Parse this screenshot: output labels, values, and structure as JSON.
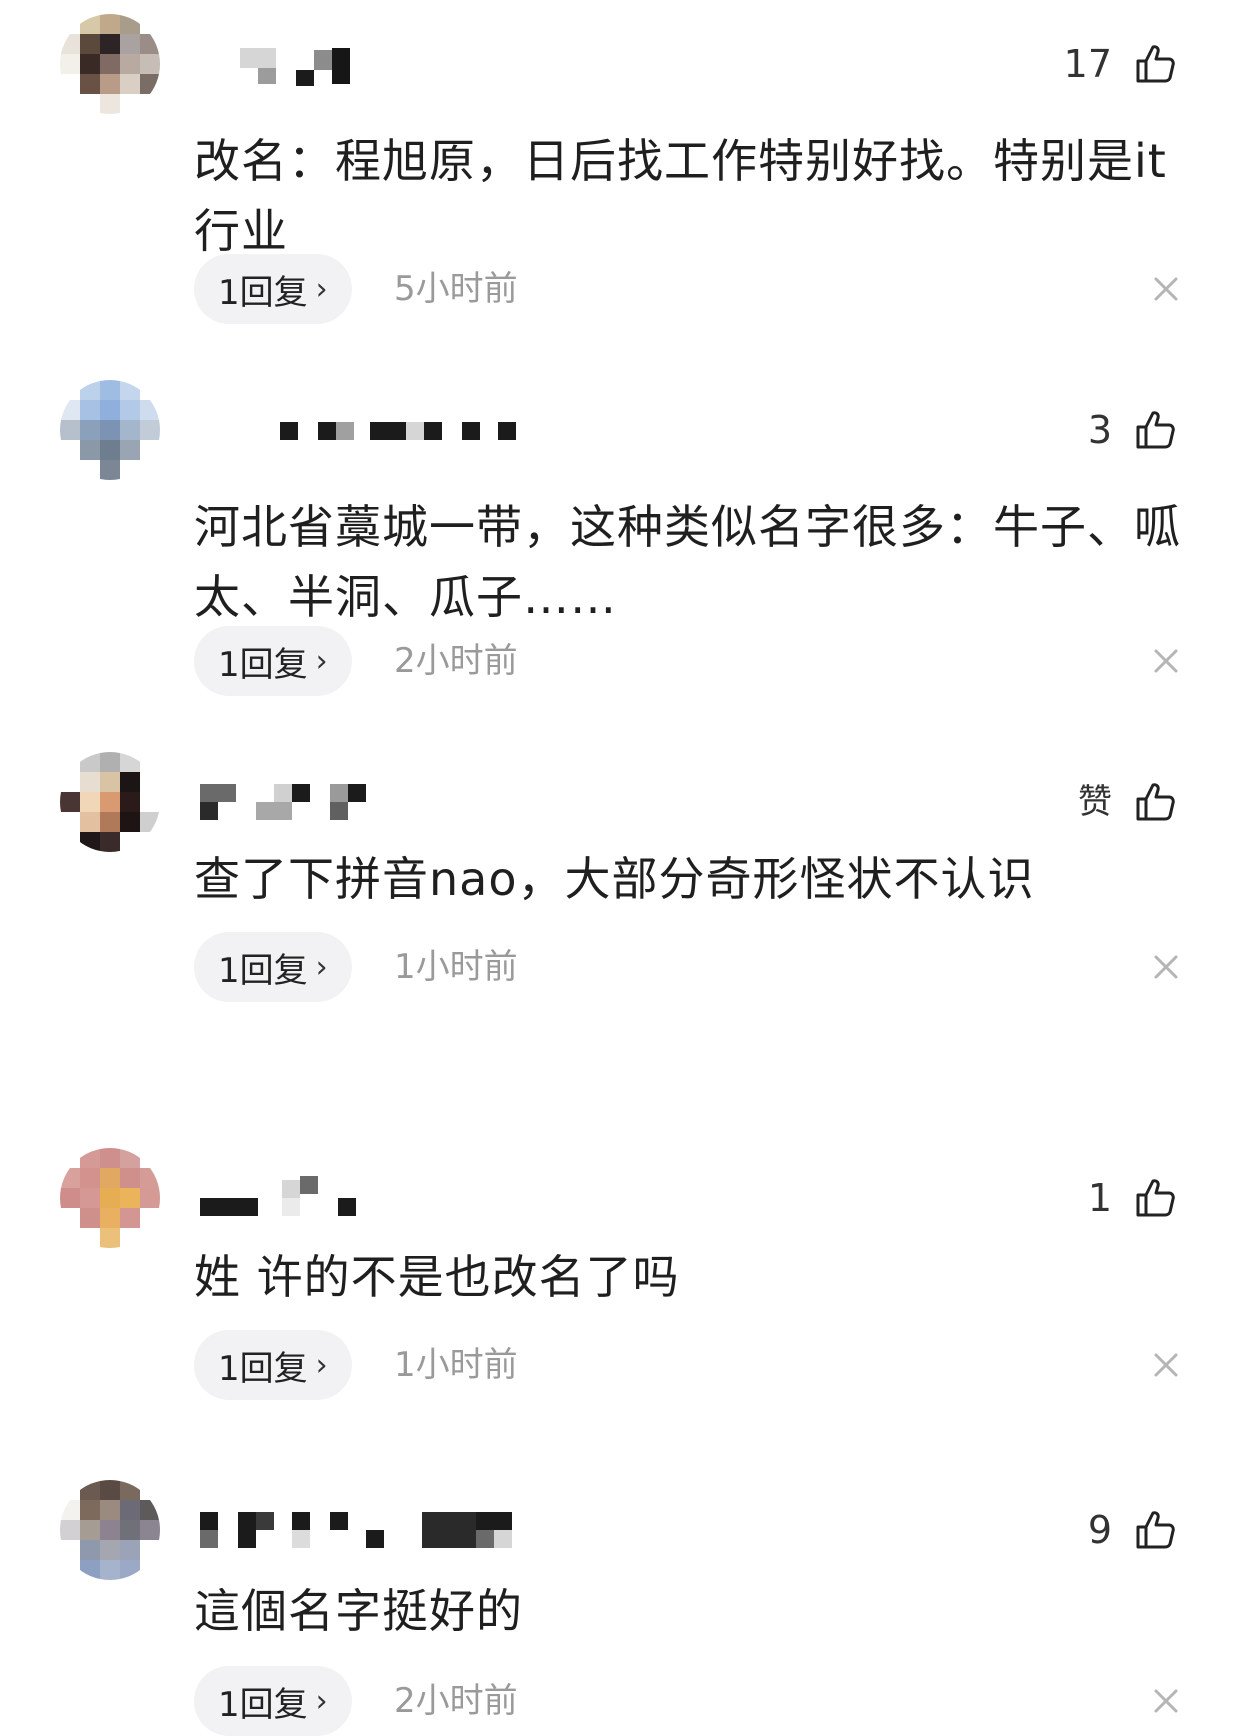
{
  "comments": [
    {
      "username_hidden": true,
      "likes": "17",
      "text": "改名：程旭原，日后找工作特别好找。特别是it行业",
      "replies": "1回复",
      "time": "5小时前",
      "avatar_colors": [
        "#ffffff",
        "#d7c8a8",
        "#bfa98a",
        "#a89c8b",
        "#ffffff",
        "#e8e2da",
        "#5b4a3c",
        "#2c2425",
        "#a9a2a0",
        "#9a8c86",
        "#f3efe9",
        "#3a2a26",
        "#7f6b63",
        "#b8aaa0",
        "#c5bdb6",
        "#ffffff",
        "#6a5145",
        "#b89c88",
        "#d9cfc4",
        "#7a6d66",
        "#ffffff",
        "#ffffff",
        "#ece6df",
        "#ffffff",
        "#ffffff"
      ]
    },
    {
      "username_hidden": true,
      "likes": "3",
      "text": "河北省藁城一带，这种类似名字很多：牛子、呱太、半洞、瓜子……",
      "replies": "1回复",
      "time": "2小时前",
      "avatar_colors": [
        "#ffffff",
        "#bcd1ea",
        "#9fbde2",
        "#c4d6ee",
        "#ffffff",
        "#dfe7f2",
        "#a7c1e4",
        "#8fb0dc",
        "#b3c9e8",
        "#cfdcee",
        "#b6c0cc",
        "#8aa0bb",
        "#7d93b3",
        "#a4b6cc",
        "#c2ccd8",
        "#ffffff",
        "#8a98a8",
        "#6f7e8f",
        "#9aa5b3",
        "#ffffff",
        "#ffffff",
        "#ffffff",
        "#7b8794",
        "#ffffff",
        "#ffffff"
      ]
    },
    {
      "username_hidden": true,
      "likes": "赞",
      "text": "查了下拼音nao，大部分奇形怪状不认识",
      "replies": "1回复",
      "time": "1小时前",
      "avatar_colors": [
        "#ffffff",
        "#c9c9c9",
        "#b0b0b0",
        "#d6d6d6",
        "#ffffff",
        "#ffffff",
        "#e7ddd0",
        "#d8c3a5",
        "#1c1515",
        "#ffffff",
        "#4a3535",
        "#f1d6b8",
        "#d99a72",
        "#2a1a1a",
        "#ffffff",
        "#ffffff",
        "#e3c0a0",
        "#b07a5a",
        "#1e1414",
        "#cfcfcf",
        "#ffffff",
        "#201818",
        "#3a2a2a",
        "#ffffff",
        "#ffffff"
      ]
    },
    {
      "username_hidden": true,
      "likes": "1",
      "text": "姓 许的不是也改名了吗",
      "replies": "1回复",
      "time": "1小时前",
      "avatar_colors": [
        "#ffffff",
        "#d59a96",
        "#cf8f8c",
        "#d5a19e",
        "#ffffff",
        "#d9a19c",
        "#d4928f",
        "#e0a860",
        "#cf908c",
        "#d59b97",
        "#ce8d8a",
        "#d69894",
        "#e7ad52",
        "#ecb45a",
        "#d49a96",
        "#ffffff",
        "#cf8f8b",
        "#e8b060",
        "#d39692",
        "#ffffff",
        "#ffffff",
        "#ffffff",
        "#eac07a",
        "#ffffff",
        "#ffffff"
      ]
    },
    {
      "username_hidden": true,
      "likes": "9",
      "text": "這個名字挺好的",
      "replies": "1回复",
      "time": "2小时前",
      "avatar_colors": [
        "#ffffff",
        "#6b5a50",
        "#5a4a44",
        "#7a6a5e",
        "#ffffff",
        "#f4f2ef",
        "#7d6a5c",
        "#9a8a80",
        "#6b6a76",
        "#5f5a5a",
        "#d2d0d2",
        "#a59c94",
        "#8d8290",
        "#707078",
        "#8a8590",
        "#ffffff",
        "#8e99ad",
        "#a4a6b0",
        "#9aa3b8",
        "#ffffff",
        "#ffffff",
        "#8da0c2",
        "#a6b3cc",
        "#9ba9c6",
        "#ffffff"
      ]
    }
  ]
}
